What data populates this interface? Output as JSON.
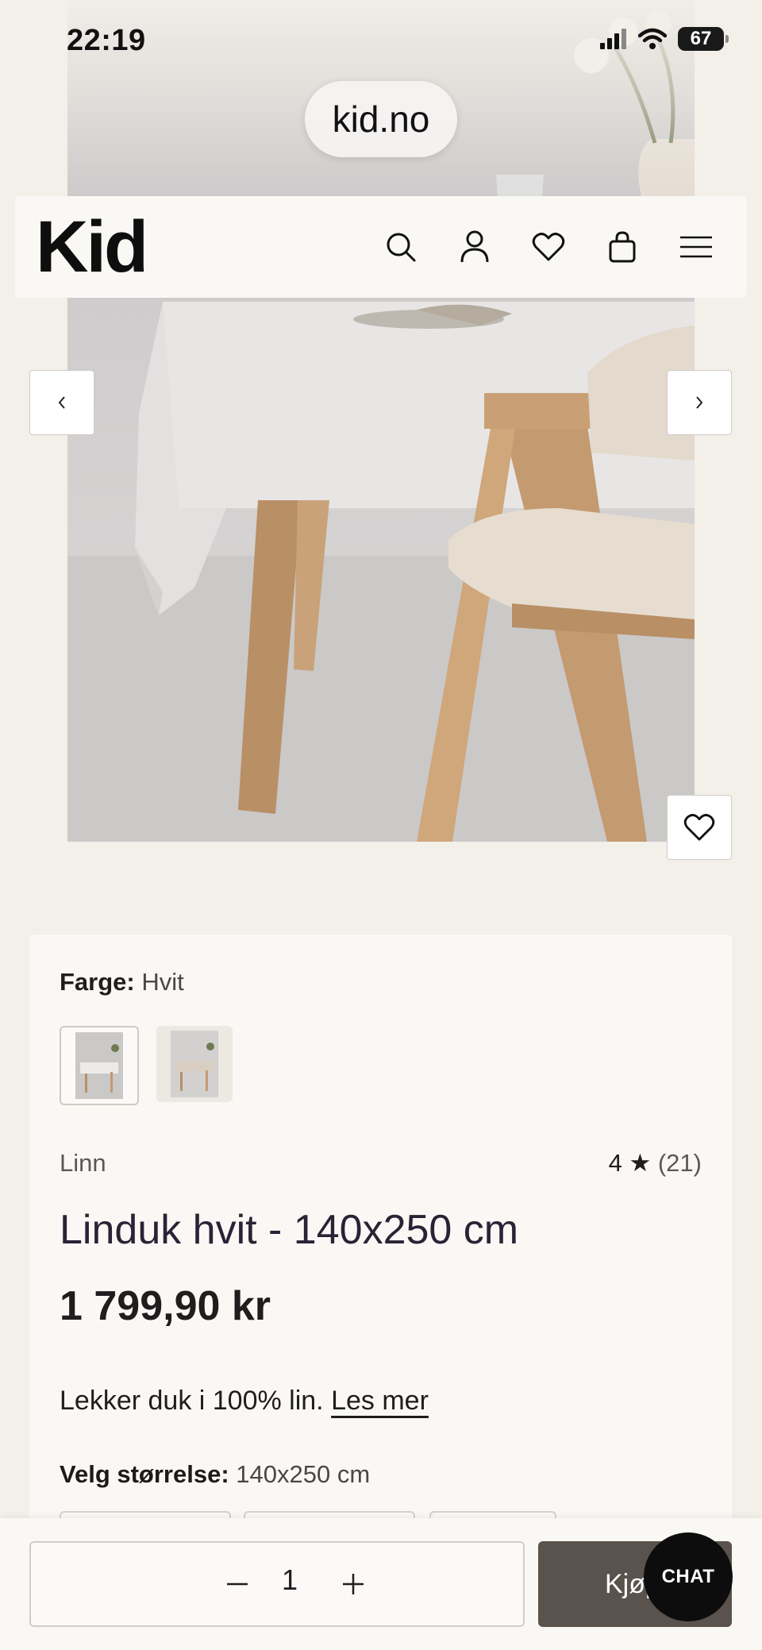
{
  "status_bar": {
    "time": "22:19",
    "battery": "67"
  },
  "browser": {
    "url": "kid.no"
  },
  "header": {
    "logo": "Kid"
  },
  "product": {
    "color_label": "Farge:",
    "color_value": "Hvit",
    "brand": "Linn",
    "rating": "4",
    "rating_count": "(21)",
    "title": "Linduk hvit - 140x250 cm",
    "price": "1 799,90 kr",
    "description": "Lekker duk i 100% lin.",
    "read_more": "Les mer",
    "size_label": "Velg størrelse:",
    "size_value": "140x250 cm"
  },
  "cart": {
    "quantity": "1",
    "buy_label": "Kjøp",
    "chat_label": "CHAT"
  },
  "colors": {
    "accent": "#5a524c",
    "background": "#f3efe9",
    "card": "#faf8f4"
  }
}
